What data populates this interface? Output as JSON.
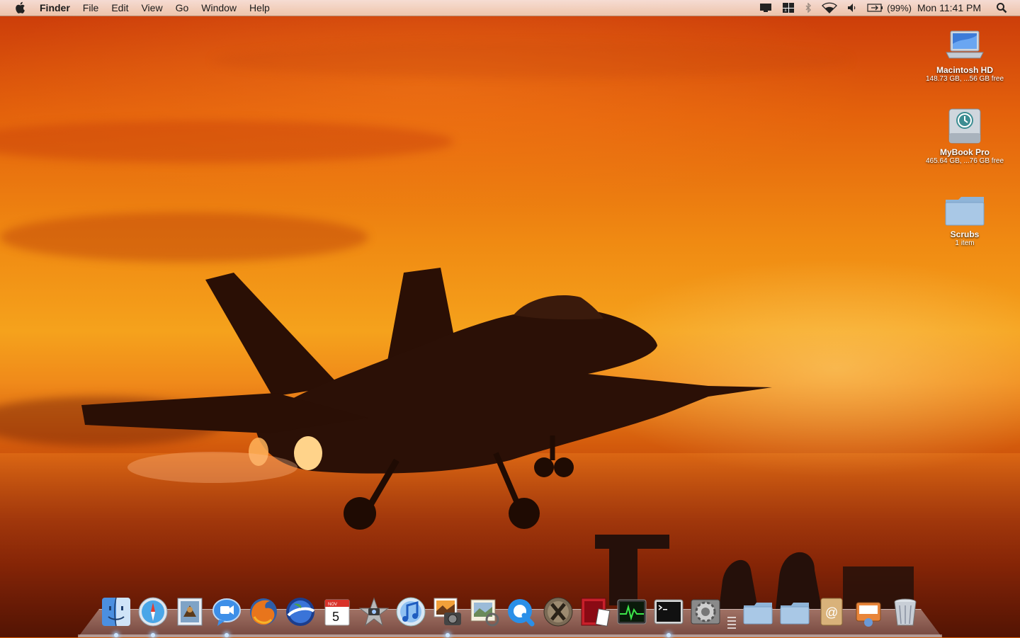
{
  "menubar": {
    "apple_icon": "apple-logo-icon",
    "app_name": "Finder",
    "menus": [
      "File",
      "Edit",
      "View",
      "Go",
      "Window",
      "Help"
    ],
    "status_icons": [
      "display-mirror-icon",
      "spaces-icon",
      "bluetooth-icon",
      "wifi-icon",
      "volume-icon",
      "battery-icon"
    ],
    "battery_text": "(99%)",
    "clock": "Mon 11:41 PM",
    "search_icon": "spotlight-icon"
  },
  "desktop_icons": [
    {
      "name": "Macintosh HD",
      "sub": "148.73 GB, ...56 GB free",
      "icon": "laptop-drive-icon"
    },
    {
      "name": "MyBook Pro",
      "sub": "465.64 GB, ...76 GB free",
      "icon": "time-machine-drive-icon"
    },
    {
      "name": "Scrubs",
      "sub": "1 item",
      "icon": "folder-icon"
    }
  ],
  "dock": {
    "apps": [
      "finder-icon",
      "safari-icon",
      "mail-icon",
      "ichat-icon",
      "firefox-icon",
      "google-earth-icon",
      "ical-icon",
      "imovie-icon",
      "itunes-icon",
      "iphoto-icon",
      "preview-icon",
      "quicktime-icon",
      "x11-icon",
      "photo-booth-icon",
      "activity-monitor-icon",
      "terminal-icon",
      "system-preferences-icon"
    ],
    "stacks": [
      "applications-folder-icon",
      "documents-folder-icon",
      "address-book-icon",
      "mail-downloads-icon",
      "trash-icon"
    ],
    "ical_month": "NOV",
    "ical_day": "5",
    "running": [
      "finder-icon",
      "safari-icon",
      "ichat-icon",
      "iphoto-icon",
      "terminal-icon"
    ]
  },
  "colors": {
    "sky_top": "#c9380a",
    "sky_mid": "#f5a21c",
    "sea": "#7a2206",
    "menubar_text": "#1a1a1a"
  }
}
